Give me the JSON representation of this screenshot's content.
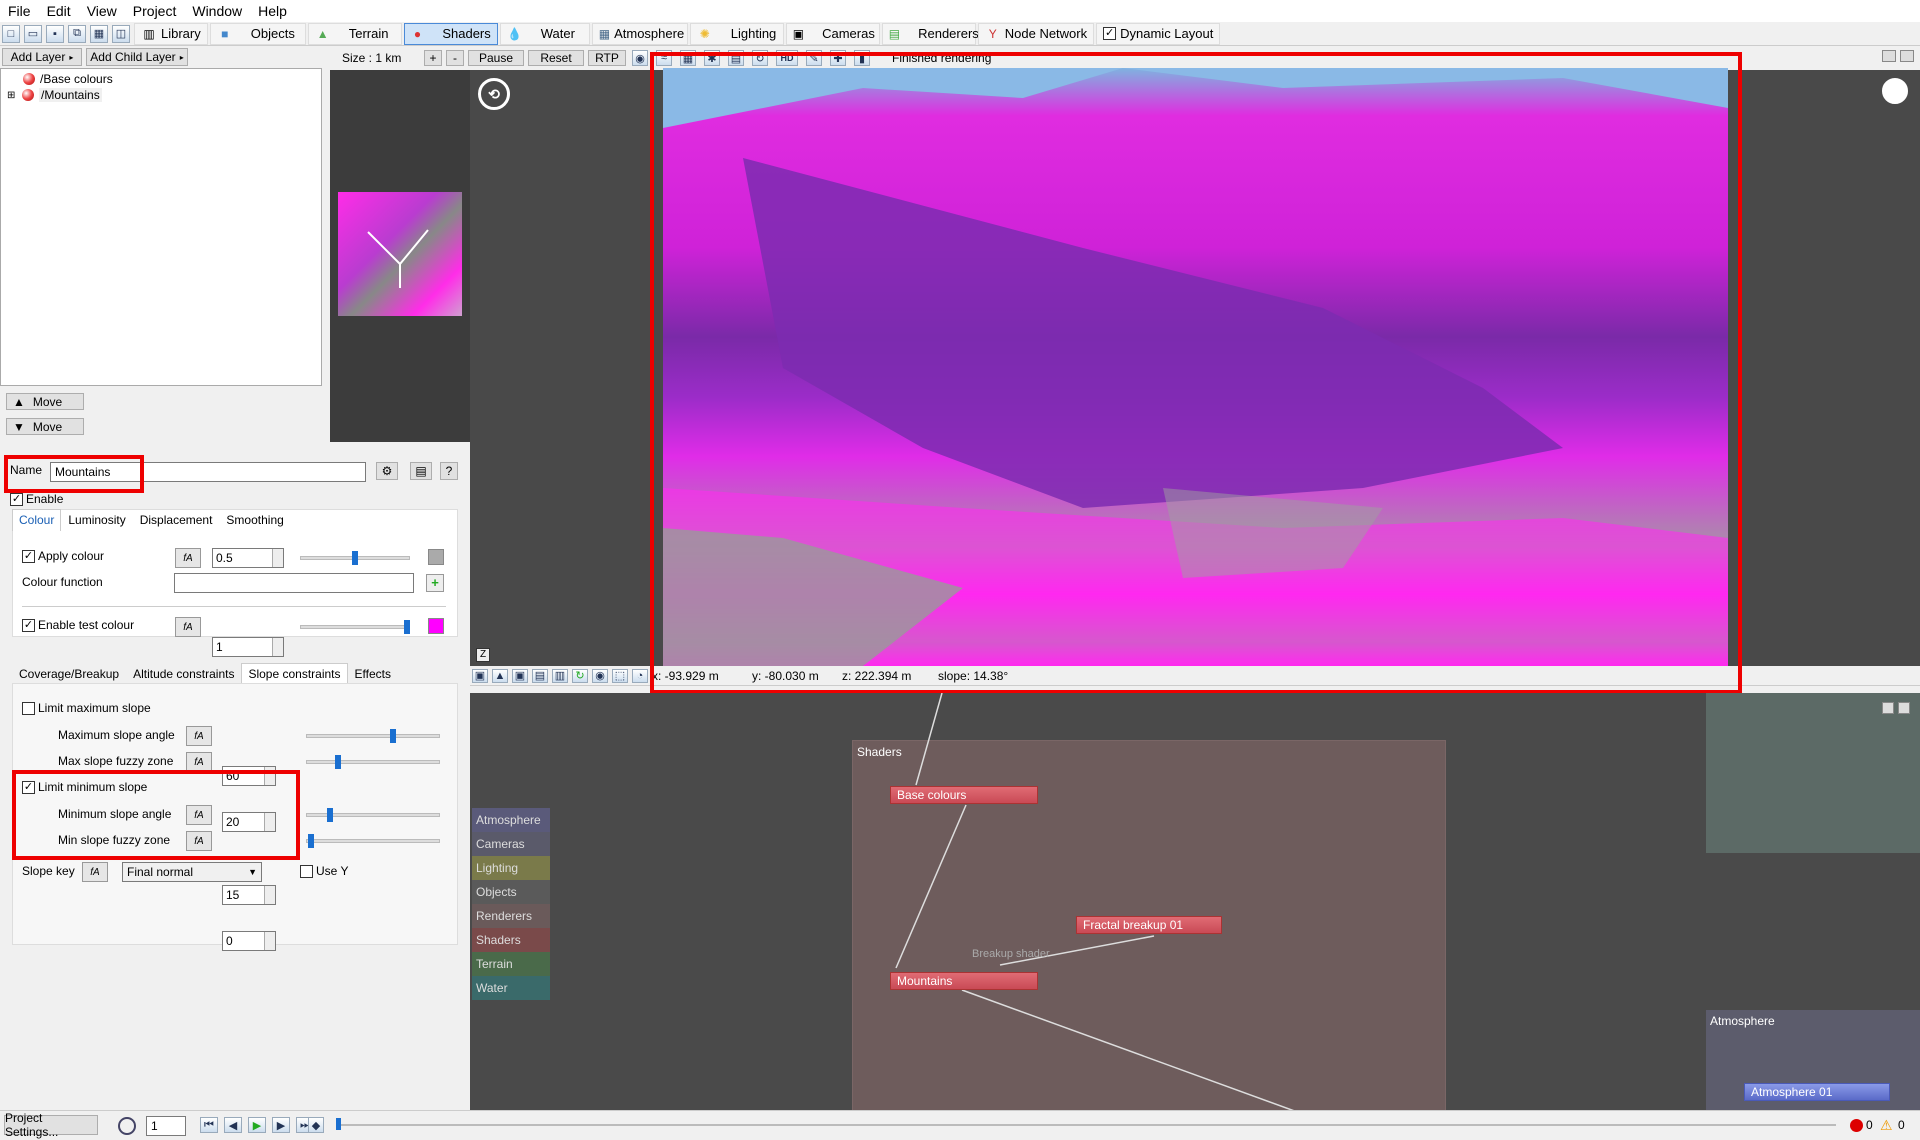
{
  "menu": [
    "File",
    "Edit",
    "View",
    "Project",
    "Window",
    "Help"
  ],
  "toolbar": {
    "tabs": [
      {
        "label": "Library",
        "icon": "library-icon"
      },
      {
        "label": "Objects",
        "icon": "objects-icon"
      },
      {
        "label": "Terrain",
        "icon": "terrain-icon"
      },
      {
        "label": "Shaders",
        "icon": "shaders-icon"
      },
      {
        "label": "Water",
        "icon": "water-icon"
      },
      {
        "label": "Atmosphere",
        "icon": "atmosphere-icon"
      },
      {
        "label": "Lighting",
        "icon": "lighting-icon"
      },
      {
        "label": "Cameras",
        "icon": "cameras-icon"
      },
      {
        "label": "Renderers",
        "icon": "renderers-icon"
      },
      {
        "label": "Node Network",
        "icon": "node-network-icon"
      }
    ],
    "dynamic_layout": "Dynamic Layout",
    "active_tab": "Shaders"
  },
  "layers": {
    "add_layer": "Add Layer",
    "add_child_layer": "Add Child Layer",
    "items": [
      "/Base colours",
      "/Mountains"
    ],
    "move_up": "Move",
    "move_down": "Move"
  },
  "preview": {
    "size": "Size : 1 km",
    "plus": "+",
    "minus": "-",
    "pause": "Pause",
    "reset": "Reset",
    "rtp": "RTP",
    "hd": "HD",
    "status": "Finished rendering"
  },
  "coords": {
    "x": "x: -93.929 m",
    "y": "y: -80.030 m",
    "z": "z: 222.394 m",
    "slope": "slope: 14.38°"
  },
  "editor": {
    "name_label": "Name",
    "name_value": "Mountains",
    "help": "?",
    "enable": "Enable",
    "tabs1": [
      "Colour",
      "Luminosity",
      "Displacement",
      "Smoothing"
    ],
    "apply_colour": "Apply colour",
    "apply_colour_value": "0.5",
    "colour_function": "Colour function",
    "enable_test_colour": "Enable test colour",
    "test_colour_value": "1",
    "test_colour": "#ff00ff",
    "tabs2": [
      "Coverage/Breakup",
      "Altitude constraints",
      "Slope constraints",
      "Effects"
    ],
    "limit_max": "Limit maximum slope",
    "max_angle_label": "Maximum slope angle",
    "max_angle": "60",
    "max_fuzzy_label": "Max slope fuzzy zone",
    "max_fuzzy": "20",
    "limit_min": "Limit minimum slope",
    "min_angle_label": "Minimum slope angle",
    "min_angle": "15",
    "min_fuzzy_label": "Min slope fuzzy zone",
    "min_fuzzy": "0",
    "slope_key": "Slope key",
    "slope_key_value": "Final normal",
    "use_y": "Use Y"
  },
  "nodes": {
    "group": "Shaders",
    "base": "Base colours",
    "fractal": "Fractal breakup 01",
    "breakup_label": "Breakup shader",
    "mountains": "Mountains",
    "atmos_group": "Atmosphere",
    "atmos_node": "Atmosphere 01",
    "legend": [
      "Atmosphere",
      "Cameras",
      "Lighting",
      "Objects",
      "Renderers",
      "Shaders",
      "Terrain",
      "Water"
    ],
    "legend_colors": [
      "#5a5a7a",
      "#5a5a6a",
      "#7a7a4a",
      "#5a5a5a",
      "#6a5a5a",
      "#7a4a4a",
      "#4a6a4a",
      "#3a6a6a"
    ]
  },
  "status": {
    "project_settings": "Project Settings...",
    "frame": "1",
    "errors": "0",
    "warnings": "0"
  }
}
